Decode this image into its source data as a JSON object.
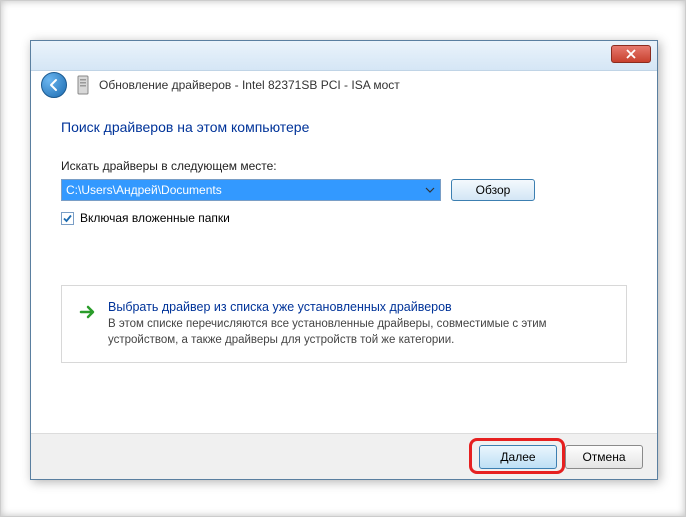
{
  "window_title": "Обновление драйверов - Intel 82371SB PCI - ISA мост",
  "heading": "Поиск драйверов на этом компьютере",
  "field_label": "Искать драйверы в следующем месте:",
  "path_value": "C:\\Users\\Андрей\\Documents",
  "browse_label": "Обзор",
  "checkbox_label": "Включая вложенные папки",
  "option": {
    "title": "Выбрать драйвер из списка уже установленных драйверов",
    "desc": "В этом списке перечисляются все установленные драйверы, совместимые с этим устройством, а также драйверы для устройств той же категории."
  },
  "next_label": "Далее",
  "cancel_label": "Отмена"
}
